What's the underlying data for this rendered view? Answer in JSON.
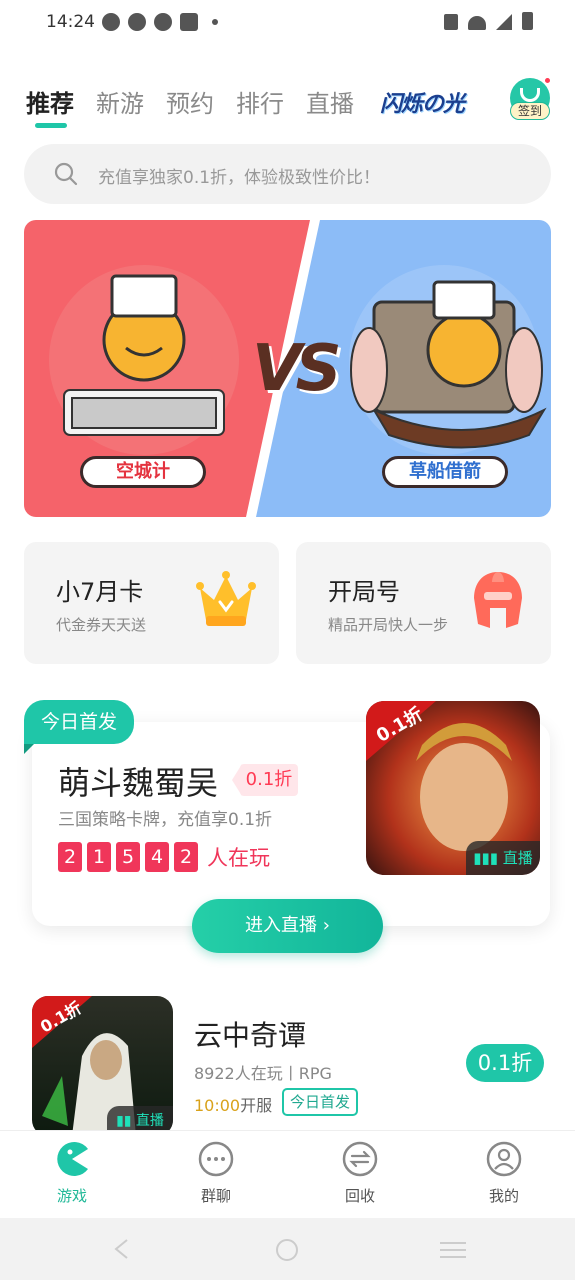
{
  "status_bar": {
    "time": "14:24"
  },
  "top_tabs": {
    "items": [
      {
        "label": "推荐",
        "active": true
      },
      {
        "label": "新游",
        "active": false
      },
      {
        "label": "预约",
        "active": false
      },
      {
        "label": "排行",
        "active": false
      },
      {
        "label": "直播",
        "active": false
      }
    ],
    "logo_text": "闪烁の光",
    "signin_label": "签到"
  },
  "search": {
    "placeholder": "充值享独家0.1折，体验极致性价比！"
  },
  "banner": {
    "left_tag": "空城计",
    "right_tag": "草船借箭",
    "vs": "VS"
  },
  "features": [
    {
      "title": "小7月卡",
      "subtitle": "代金券天天送",
      "icon": "crown-icon"
    },
    {
      "title": "开局号",
      "subtitle": "精品开局快人一步",
      "icon": "helmet-icon"
    }
  ],
  "today_first": {
    "badge": "今日首发",
    "title": "萌斗魏蜀吴",
    "discount_label": "0.1折",
    "description": "三国策略卡牌，充值享0.1折",
    "playing_digits": [
      "2",
      "1",
      "5",
      "4",
      "2"
    ],
    "playing_suffix": "人在玩",
    "art_discount": "0.1折",
    "art_live": "直播",
    "button_label": "进入直播 ›"
  },
  "game_list": [
    {
      "title": "云中奇谭",
      "meta": "8922人在玩丨RPG",
      "open_time": "10:00",
      "open_suffix": "开服",
      "first_tag": "今日首发",
      "discount_label": "0.1折",
      "art_discount": "0.1折",
      "art_live": "直播"
    }
  ],
  "bottom_nav": [
    {
      "label": "游戏",
      "icon": "pacman-icon",
      "active": true
    },
    {
      "label": "群聊",
      "icon": "chat-icon",
      "active": false
    },
    {
      "label": "回收",
      "icon": "recycle-icon",
      "active": false
    },
    {
      "label": "我的",
      "icon": "user-icon",
      "active": false
    }
  ],
  "colors": {
    "accent": "#1fc6a8",
    "discount": "#f0365a",
    "banner_left": "#f5636a",
    "banner_right": "#8cbcf7"
  }
}
